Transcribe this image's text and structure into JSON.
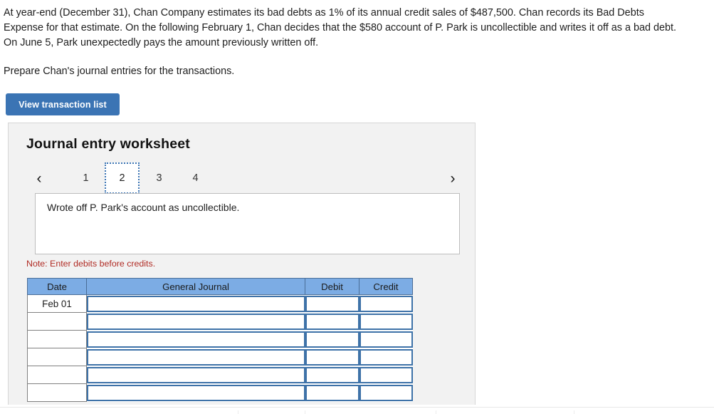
{
  "problem": {
    "paragraph_1": "At year-end (December 31), Chan Company estimates its bad debts as 1% of its annual credit sales of $487,500. Chan records its Bad Debts Expense for that estimate. On the following February 1, Chan decides that the $580 account of P. Park is uncollectible and writes it off as a bad debt. On June 5, Park unexpectedly pays the amount previously written off.",
    "paragraph_2": "Prepare Chan's journal entries for the transactions."
  },
  "toolbar": {
    "view_transaction_list_label": "View transaction list"
  },
  "worksheet": {
    "title": "Journal entry worksheet",
    "pager": {
      "prev_icon": "chevron-left-icon",
      "next_icon": "chevron-right-icon",
      "prev_glyph": "‹",
      "next_glyph": "›",
      "tabs": [
        {
          "label": "1",
          "active": false
        },
        {
          "label": "2",
          "active": true
        },
        {
          "label": "3",
          "active": false
        },
        {
          "label": "4",
          "active": false
        }
      ]
    },
    "description": "Wrote off P. Park's account as uncollectible.",
    "note": "Note: Enter debits before credits.",
    "table": {
      "columns": [
        "Date",
        "General Journal",
        "Debit",
        "Credit"
      ],
      "rows": [
        {
          "date": "Feb 01",
          "general_journal": "",
          "debit": "",
          "credit": ""
        },
        {
          "date": "",
          "general_journal": "",
          "debit": "",
          "credit": ""
        },
        {
          "date": "",
          "general_journal": "",
          "debit": "",
          "credit": ""
        },
        {
          "date": "",
          "general_journal": "",
          "debit": "",
          "credit": ""
        },
        {
          "date": "",
          "general_journal": "",
          "debit": "",
          "credit": ""
        },
        {
          "date": "",
          "general_journal": "",
          "debit": "",
          "credit": ""
        }
      ]
    }
  },
  "colors": {
    "button_blue": "#3b74b4",
    "table_header_blue": "#7cace4",
    "input_border_blue": "#3e72a8",
    "note_red": "#b02b24",
    "panel_gray": "#f2f2f2"
  }
}
